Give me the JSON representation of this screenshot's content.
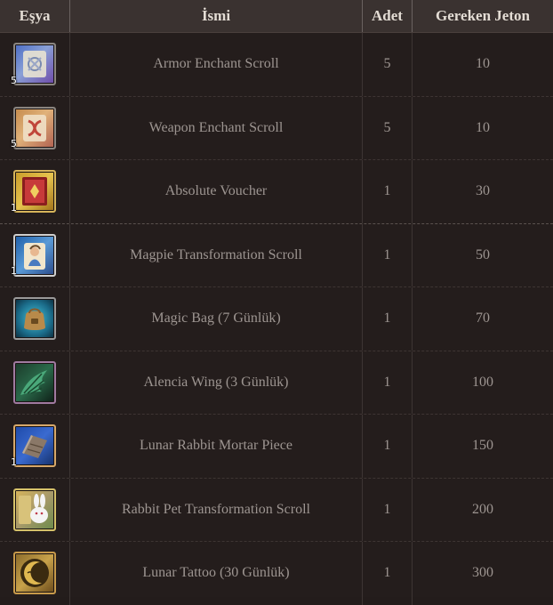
{
  "columns": {
    "item": "Eşya",
    "name": "İsmi",
    "quantity": "Adet",
    "price": "Gereken Jeton"
  },
  "rows": [
    {
      "icon": "armor-enchant-scroll-icon",
      "stack": "5",
      "name": "Armor Enchant Scroll",
      "quantity": "5",
      "price": "10"
    },
    {
      "icon": "weapon-enchant-scroll-icon",
      "stack": "5",
      "name": "Weapon Enchant Scroll",
      "quantity": "5",
      "price": "10"
    },
    {
      "icon": "absolute-voucher-icon",
      "stack": "1",
      "name": "Absolute Voucher",
      "quantity": "1",
      "price": "30"
    },
    {
      "icon": "magpie-transformation-scroll-icon",
      "stack": "1",
      "name": "Magpie Transformation Scroll",
      "quantity": "1",
      "price": "50"
    },
    {
      "icon": "magic-bag-icon",
      "stack": "",
      "name": "Magic Bag (7 Günlük)",
      "quantity": "1",
      "price": "70"
    },
    {
      "icon": "alencia-wing-icon",
      "stack": "",
      "name": "Alencia Wing (3 Günlük)",
      "quantity": "1",
      "price": "100"
    },
    {
      "icon": "lunar-rabbit-mortar-piece-icon",
      "stack": "1",
      "name": "Lunar Rabbit Mortar Piece",
      "quantity": "1",
      "price": "150"
    },
    {
      "icon": "rabbit-pet-transformation-scroll-icon",
      "stack": "",
      "name": "Rabbit Pet Transformation Scroll",
      "quantity": "1",
      "price": "200"
    },
    {
      "icon": "lunar-tattoo-icon",
      "stack": "",
      "name": "Lunar Tattoo (30 Günlük)",
      "quantity": "1",
      "price": "300"
    }
  ]
}
